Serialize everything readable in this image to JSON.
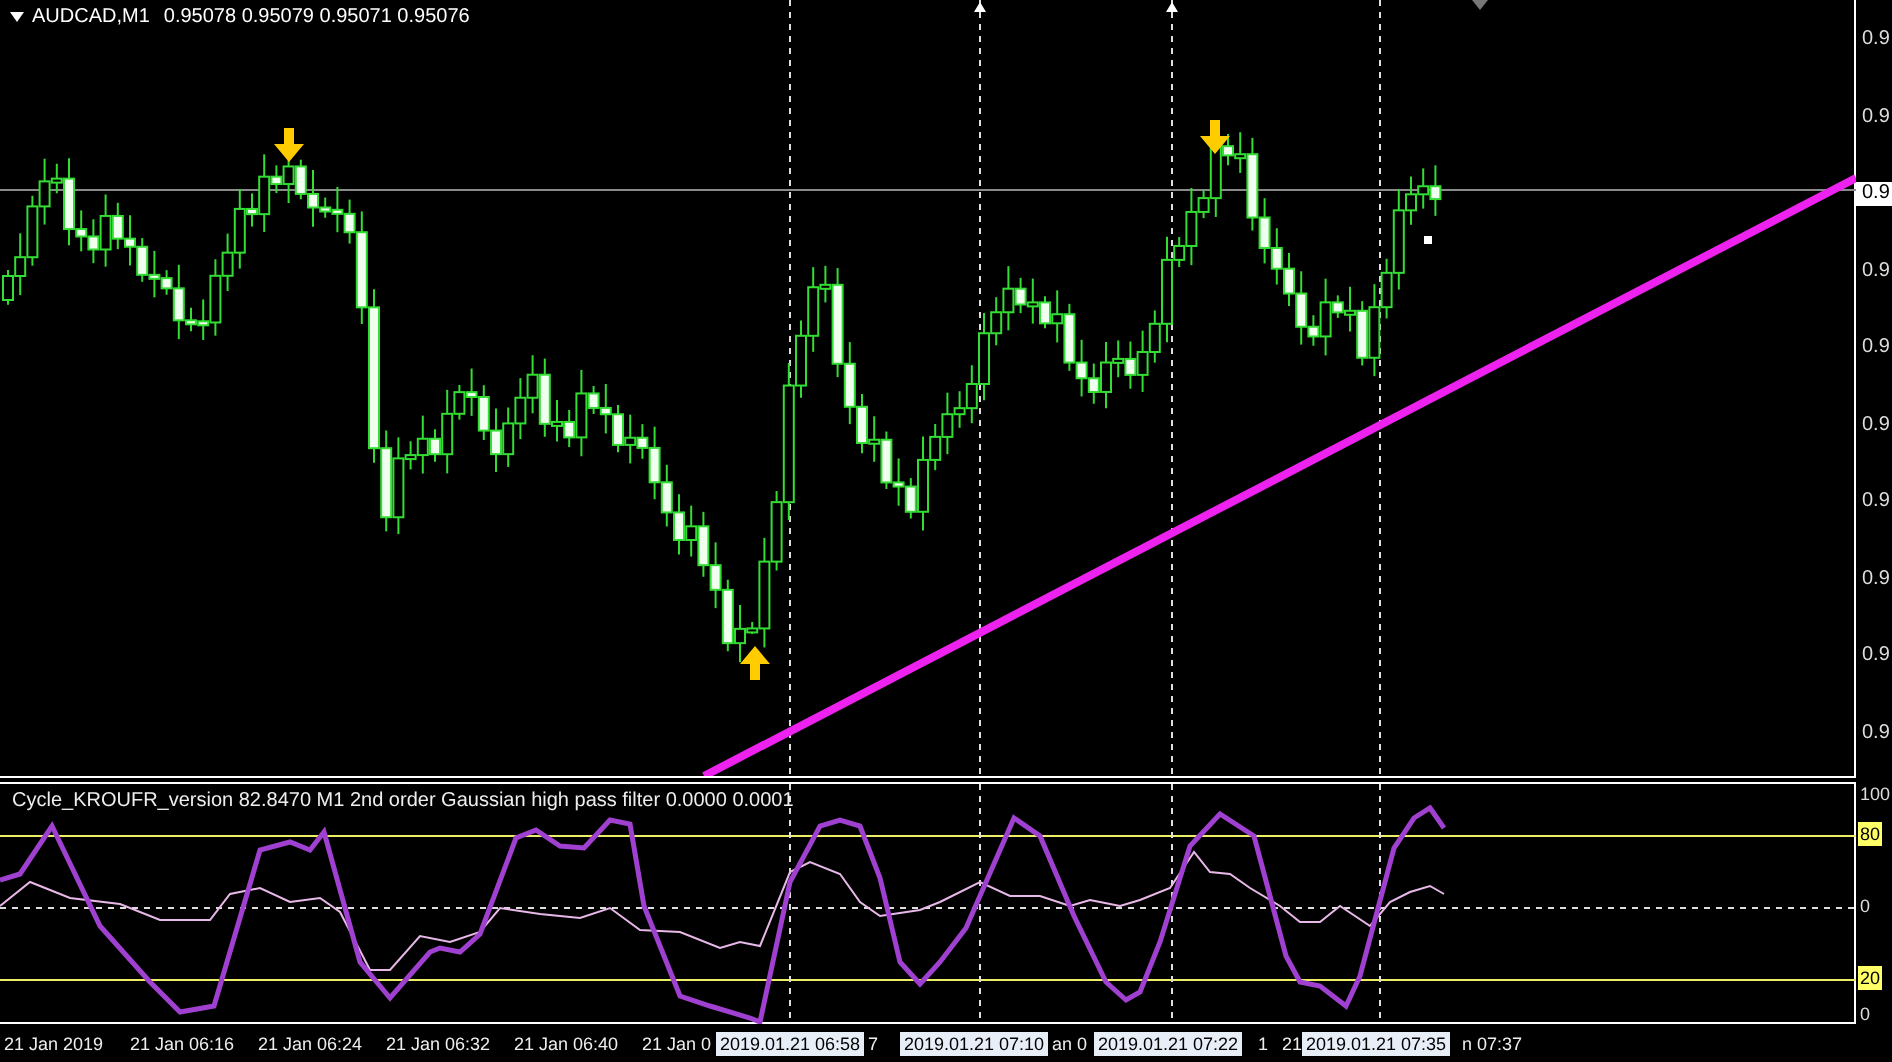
{
  "chart_header": {
    "symbol": "AUDCAD,M1",
    "quote": "0.95078 0.95079 0.95071 0.95076"
  },
  "price_axis": [
    {
      "text": "0.9",
      "kind": "tick"
    },
    {
      "text": "0.9",
      "kind": "tick"
    },
    {
      "text": "0.9",
      "kind": "current"
    },
    {
      "text": "0.9",
      "kind": "tick"
    },
    {
      "text": "0.9",
      "kind": "tick"
    },
    {
      "text": "0.9",
      "kind": "tick"
    },
    {
      "text": "0.9",
      "kind": "tick"
    },
    {
      "text": "0.9",
      "kind": "tick"
    },
    {
      "text": "0.9",
      "kind": "tick"
    },
    {
      "text": "0.9",
      "kind": "tick"
    }
  ],
  "indicator": {
    "title": "Cycle_KROUFR_version 82.8470  M1 2nd order Gaussian high pass filter 0.0000 0.0001",
    "axis": [
      {
        "text": "100",
        "kind": "plain"
      },
      {
        "text": "80",
        "kind": "level"
      },
      {
        "text": "0",
        "kind": "plain"
      },
      {
        "text": "20",
        "kind": "level"
      },
      {
        "text": "0",
        "kind": "plain"
      }
    ]
  },
  "time_axis": [
    {
      "text": "21 Jan 2019",
      "kind": "tick"
    },
    {
      "text": "21 Jan 06:16",
      "kind": "tick"
    },
    {
      "text": "21 Jan 06:24",
      "kind": "tick"
    },
    {
      "text": "21 Jan 06:32",
      "kind": "tick"
    },
    {
      "text": "21 Jan 06:40",
      "kind": "tick"
    },
    {
      "text": "21 Jan 0",
      "kind": "tick"
    },
    {
      "text": "2019.01.21 06:58",
      "kind": "crosshair"
    },
    {
      "text": "7",
      "kind": "tick"
    },
    {
      "text": "2019.01.21 07:10",
      "kind": "crosshair"
    },
    {
      "text": "an 0",
      "kind": "tick"
    },
    {
      "text": "2019.01.21 07:22",
      "kind": "crosshair"
    },
    {
      "text": "1",
      "kind": "tick"
    },
    {
      "text": "21",
      "kind": "tick"
    },
    {
      "text": "2019.01.21 07:35",
      "kind": "crosshair"
    },
    {
      "text": "n 07:37",
      "kind": "tick"
    }
  ]
}
